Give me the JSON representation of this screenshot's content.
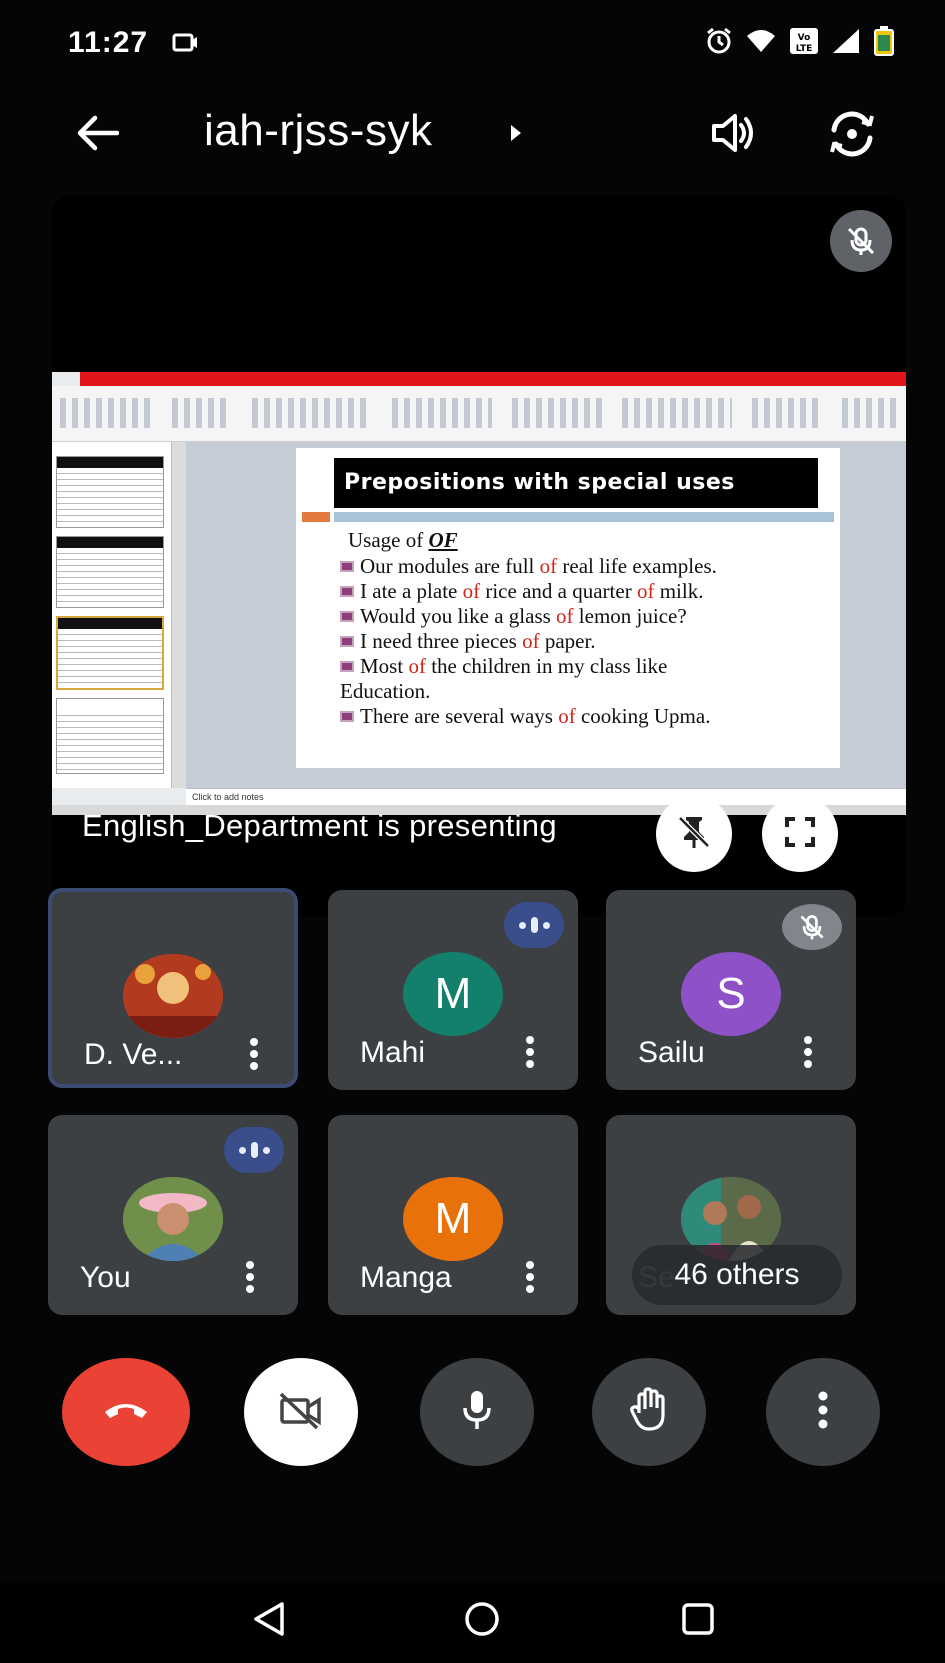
{
  "status_bar": {
    "time": "11:27",
    "icons": [
      "cast-icon",
      "alarm-icon",
      "wifi-icon",
      "volte-icon",
      "signal-icon",
      "battery-icon"
    ]
  },
  "header": {
    "meeting_code": "iah-rjss-syk",
    "icons": [
      "back-arrow-icon",
      "caret-right-icon",
      "speaker-icon",
      "switch-camera-icon"
    ]
  },
  "presentation": {
    "presenting_label": "English_Department is presenting",
    "slide": {
      "title": "Prepositions with special uses",
      "usage_prefix": "Usage of ",
      "usage_keyword": "OF",
      "lines": [
        {
          "before": "Our modules are full ",
          "of": "of",
          "after": " real life  examples."
        },
        {
          "before": "I ate a plate ",
          "of": "of",
          "after": " rice and a quarter ",
          "of2": "of",
          "after2": " milk."
        },
        {
          "before": "Would you like a glass ",
          "of": "of",
          "after": " lemon juice?"
        },
        {
          "before": " I need three pieces ",
          "of": "of",
          "after": " paper."
        },
        {
          "before": "Most ",
          "of": "of",
          "after": " the children in my class like"
        },
        {
          "before": "Education.",
          "of": "",
          "after": ""
        },
        {
          "before": "There are several ways ",
          "of": "of",
          "after": " cooking Upma."
        }
      ],
      "notes_placeholder": "Click to add notes"
    }
  },
  "participants": [
    {
      "name": "D. Ve...",
      "avatar_type": "photo",
      "avatar_color": "#c0392b",
      "indicator": "none",
      "active": true
    },
    {
      "name": "Mahi",
      "avatar_type": "letter",
      "letter": "M",
      "avatar_color": "#12806a",
      "indicator": "speaking"
    },
    {
      "name": "Sailu",
      "avatar_type": "letter",
      "letter": "S",
      "avatar_color": "#8e51c7",
      "indicator": "muted"
    },
    {
      "name": "You",
      "avatar_type": "photo",
      "avatar_color": "#7a8a5a",
      "indicator": "speaking"
    },
    {
      "name": "Manga",
      "avatar_type": "letter",
      "letter": "M",
      "avatar_color": "#e8710a",
      "indicator": "none"
    },
    {
      "name": "Se",
      "avatar_type": "photo",
      "avatar_color": "#6c7a5a",
      "indicator": "none",
      "others_label": "46 others"
    }
  ],
  "colors": {
    "end_call": "#ea4335",
    "tile_bg": "#3c4043",
    "speaking_badge": "#3a4e8c",
    "active_border": "#3b4b73"
  }
}
